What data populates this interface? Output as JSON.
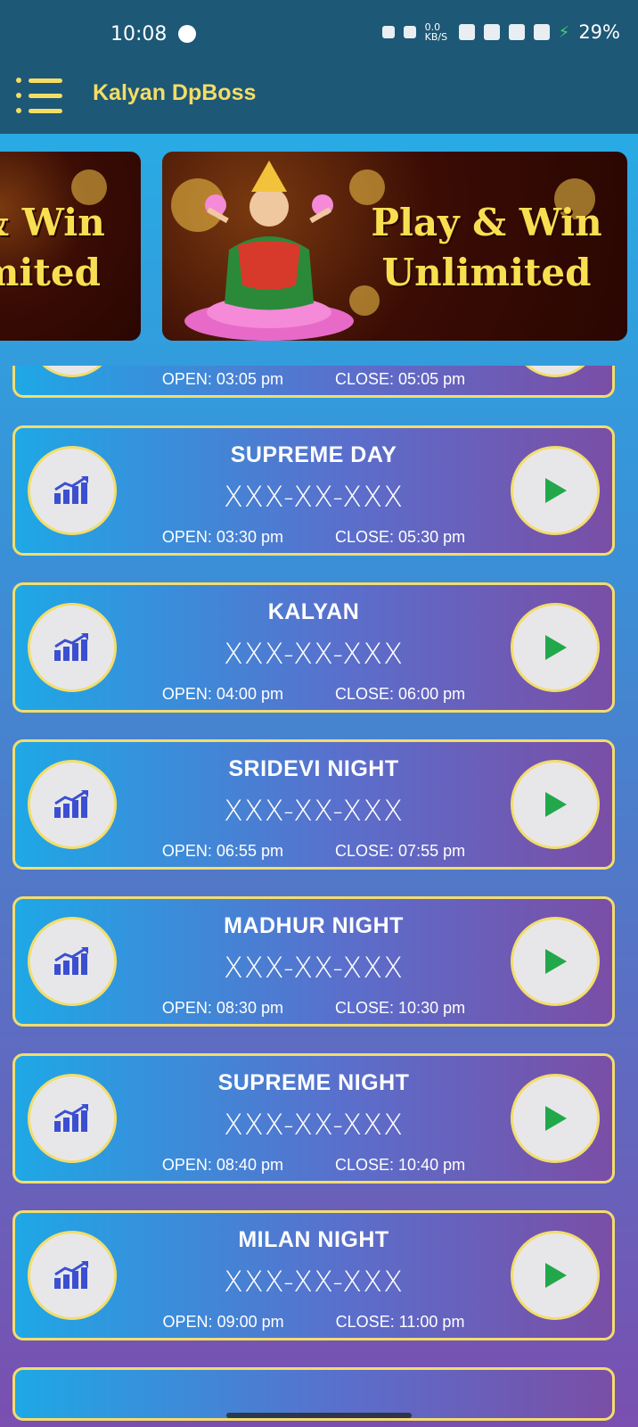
{
  "status_bar": {
    "time": "10:08",
    "net_speed": "0.0 KB/S",
    "battery": "29%"
  },
  "app_bar": {
    "title": "Kalyan DpBoss"
  },
  "banner": {
    "left_text_line1": "& Win",
    "left_text_line2": "mited",
    "main_text_line1": "Play & Win",
    "main_text_line2": "Unlimited"
  },
  "labels": {
    "open": "OPEN:",
    "close": "CLOSE:"
  },
  "games": [
    {
      "name": "",
      "result": "",
      "open": "03:05 pm",
      "close": "05:05 pm"
    },
    {
      "name": "SUPREME DAY",
      "result": "XXX-XX-XXX",
      "open": "03:30 pm",
      "close": "05:30 pm"
    },
    {
      "name": "KALYAN",
      "result": "XXX-XX-XXX",
      "open": "04:00 pm",
      "close": "06:00 pm"
    },
    {
      "name": "SRIDEVI NIGHT",
      "result": "XXX-XX-XXX",
      "open": "06:55 pm",
      "close": "07:55 pm"
    },
    {
      "name": "MADHUR NIGHT",
      "result": "XXX-XX-XXX",
      "open": "08:30 pm",
      "close": "10:30 pm"
    },
    {
      "name": "SUPREME NIGHT",
      "result": "XXX-XX-XXX",
      "open": "08:40 pm",
      "close": "10:40 pm"
    },
    {
      "name": "MILAN NIGHT",
      "result": "XXX-XX-XXX",
      "open": "09:00 pm",
      "close": "11:00 pm"
    }
  ],
  "colors": {
    "header_bg": "#1d5876",
    "accent_yellow": "#f5dd64",
    "play_green": "#22a84a",
    "chart_blue": "#3b4fd0"
  }
}
